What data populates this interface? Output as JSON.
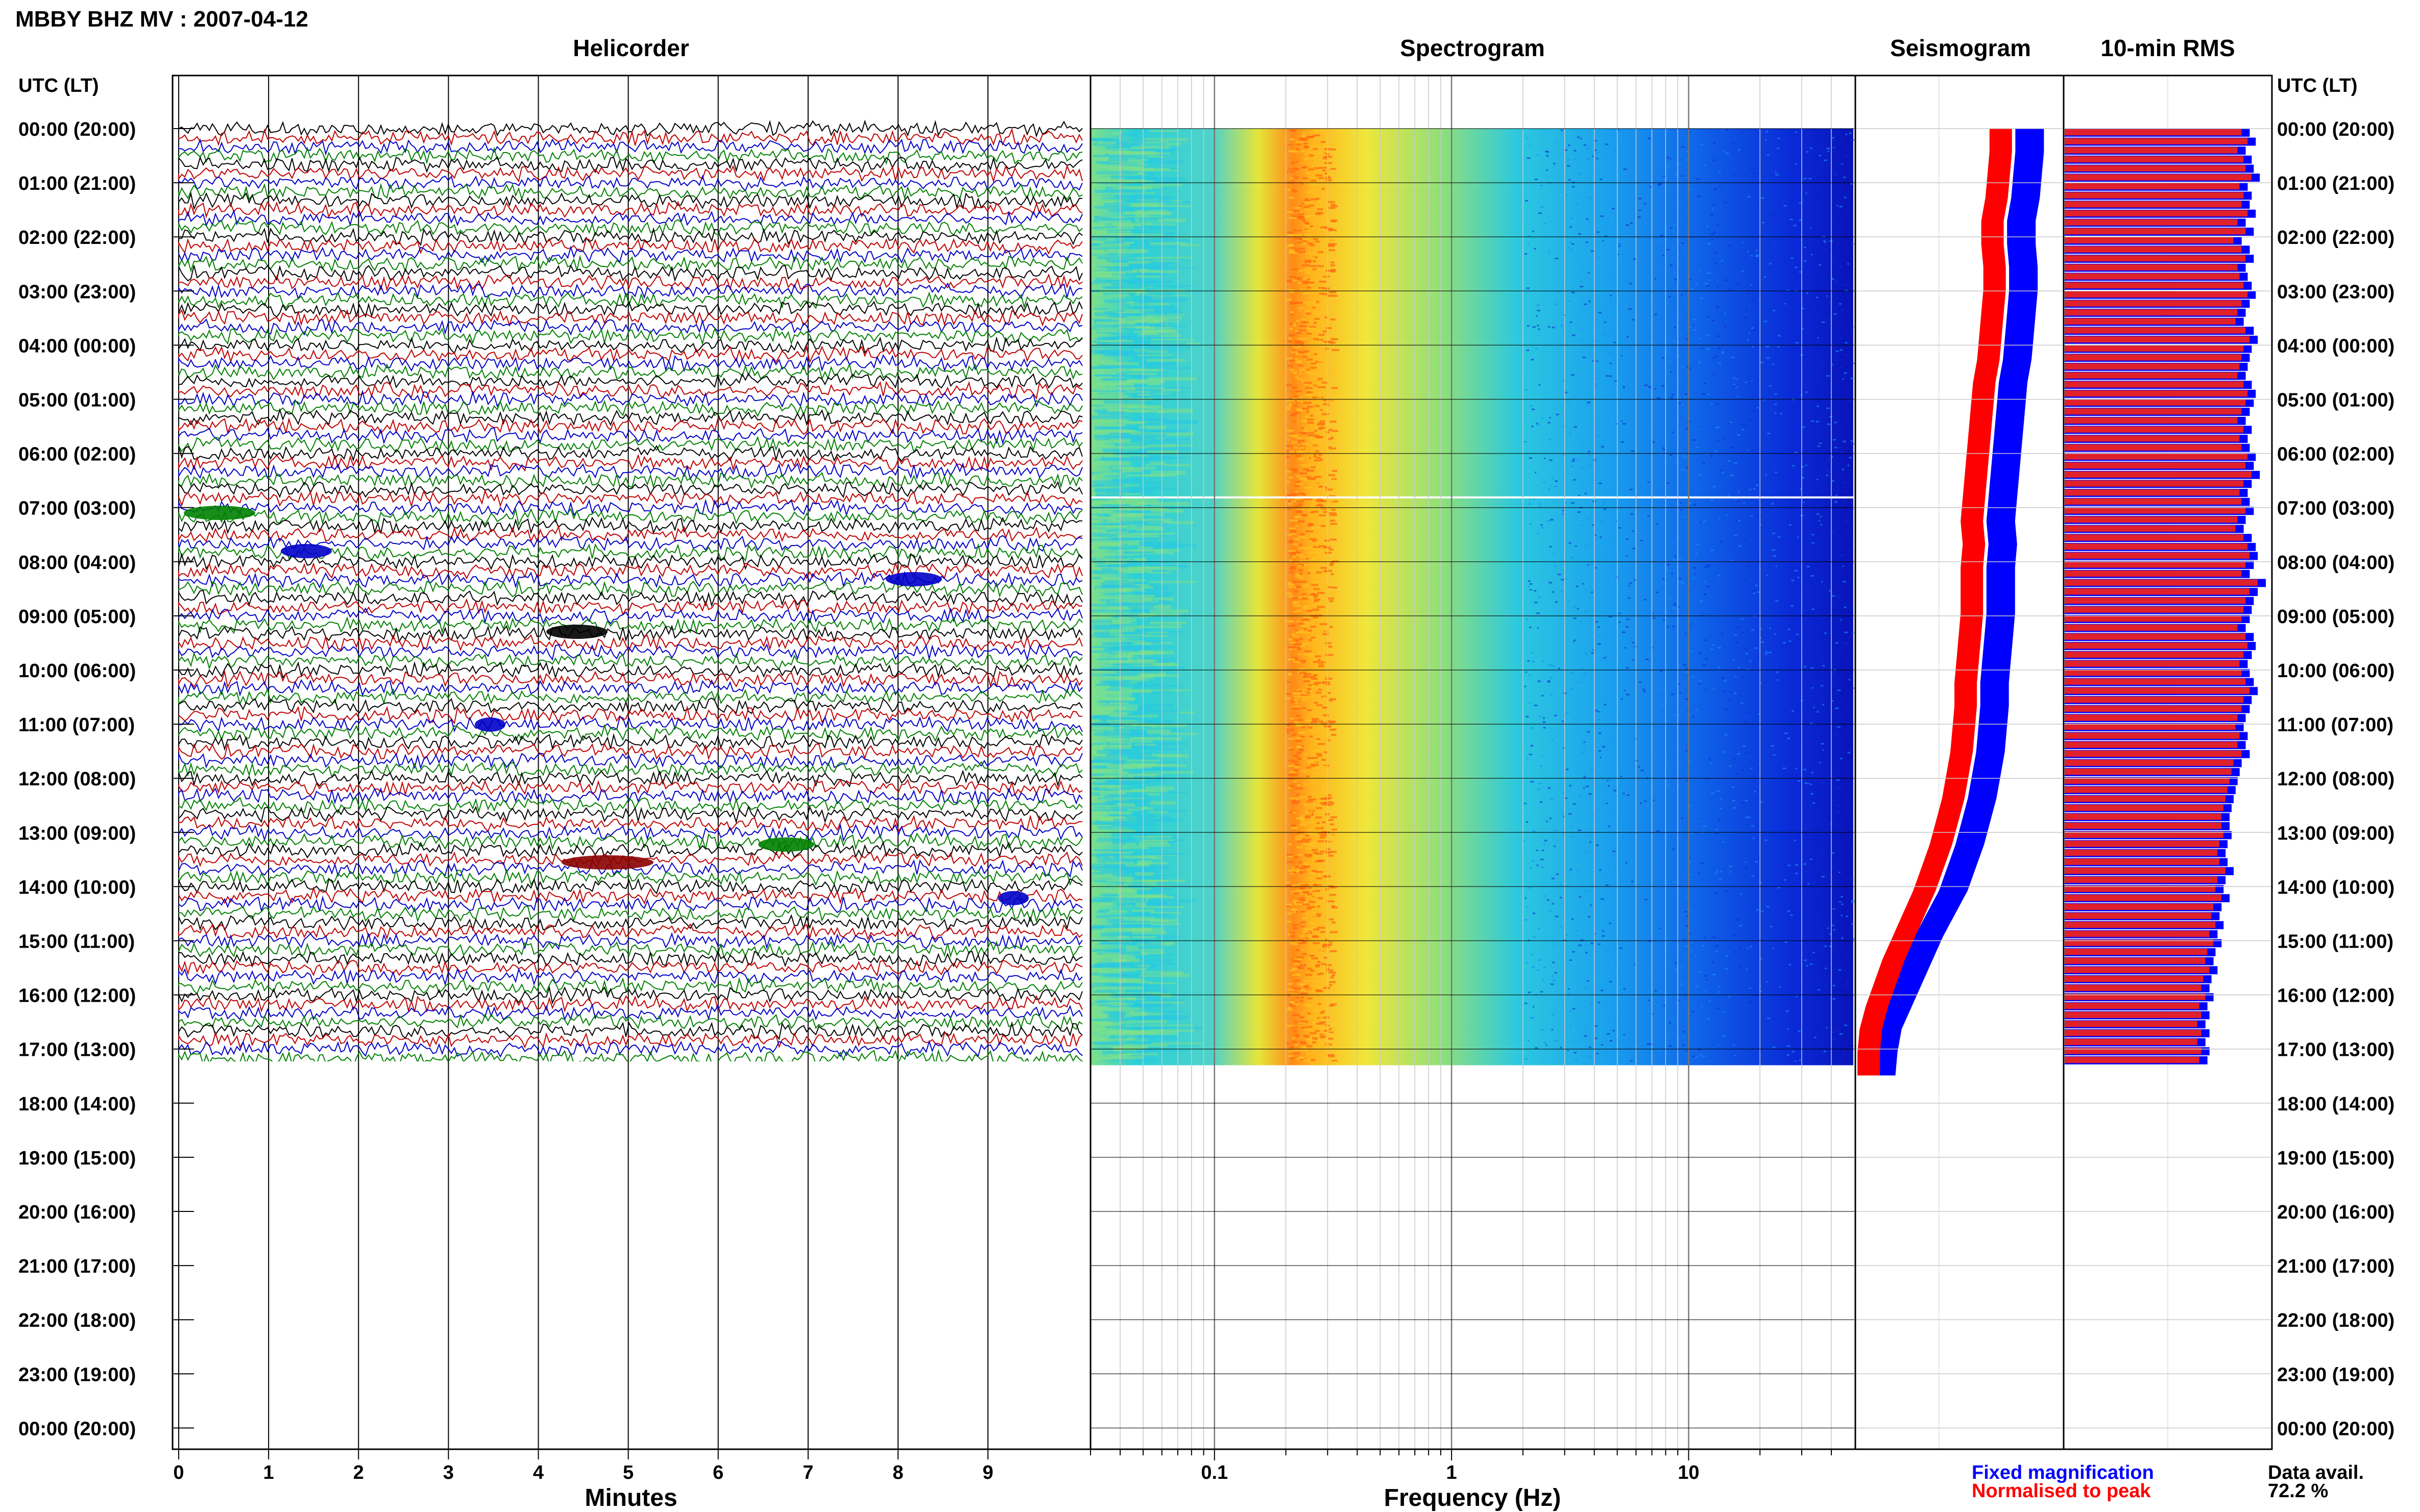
{
  "header": {
    "title": "MBBY BHZ MV : 2007-04-12"
  },
  "panels": {
    "helicorder": "Helicorder",
    "spectrogram": "Spectrogram",
    "seismogram": "Seismogram",
    "rms": "10-min RMS"
  },
  "axis": {
    "time_header_left": "UTC (LT)",
    "time_header_right": "UTC (LT)",
    "minutes_label": "Minutes",
    "frequency_label": "Frequency (Hz)",
    "minute_ticks": [
      "0",
      "1",
      "2",
      "3",
      "4",
      "5",
      "6",
      "7",
      "8",
      "9"
    ],
    "freq_ticks": [
      "0.1",
      "1",
      "10"
    ]
  },
  "legend": {
    "fixed": "Fixed magnification",
    "normalised": "Normalised to peak",
    "fixed_color": "#0000ff",
    "normalised_color": "#ff0000"
  },
  "availability": {
    "label": "Data avail.",
    "value": "72.2 %"
  },
  "chart_data": {
    "type": "heatmap",
    "time_labels": [
      "00:00 (20:00)",
      "01:00 (21:00)",
      "02:00 (22:00)",
      "03:00 (23:00)",
      "04:00 (00:00)",
      "05:00 (01:00)",
      "06:00 (02:00)",
      "07:00 (03:00)",
      "08:00 (04:00)",
      "09:00 (05:00)",
      "10:00 (06:00)",
      "11:00 (07:00)",
      "12:00 (08:00)",
      "13:00 (09:00)",
      "14:00 (10:00)",
      "15:00 (11:00)",
      "16:00 (12:00)",
      "17:00 (13:00)",
      "18:00 (14:00)",
      "19:00 (15:00)",
      "20:00 (16:00)",
      "21:00 (17:00)",
      "22:00 (18:00)",
      "23:00 (19:00)",
      "00:00 (20:00)"
    ],
    "data_hours": 17.3,
    "data_availability_percent": 72.2,
    "minutes_range": [
      0,
      10
    ],
    "frequency_range_hz": [
      0.03,
      50
    ],
    "frequency_scale": "log",
    "trace_colors": [
      "#000000",
      "#c00000",
      "#0000c8",
      "#008000"
    ],
    "spectrogram_peak_hz": 0.25,
    "seismogram_fixed_rel_x": [
      0.84,
      0.84,
      0.83,
      0.82,
      0.8,
      0.8,
      0.81,
      0.81,
      0.8,
      0.79,
      0.78,
      0.76,
      0.75,
      0.74,
      0.73,
      0.72,
      0.71,
      0.7,
      0.71,
      0.7,
      0.7,
      0.7,
      0.69,
      0.68,
      0.67,
      0.67,
      0.66,
      0.65,
      0.63,
      0.61,
      0.58,
      0.55,
      0.51,
      0.47,
      0.41,
      0.35,
      0.3,
      0.25,
      0.2,
      0.15,
      0.13,
      0.12
    ],
    "seismogram_norm_rel_x": [
      0.7,
      0.7,
      0.69,
      0.68,
      0.66,
      0.66,
      0.67,
      0.67,
      0.66,
      0.65,
      0.64,
      0.62,
      0.61,
      0.6,
      0.59,
      0.58,
      0.57,
      0.56,
      0.57,
      0.56,
      0.56,
      0.56,
      0.55,
      0.54,
      0.53,
      0.53,
      0.52,
      0.51,
      0.49,
      0.47,
      0.44,
      0.41,
      0.37,
      0.33,
      0.28,
      0.23,
      0.18,
      0.14,
      0.1,
      0.07,
      0.06,
      0.06
    ],
    "rms_rel": [
      0.92,
      0.95,
      0.9,
      0.93,
      0.94,
      0.97,
      0.91,
      0.93,
      0.92,
      0.95,
      0.9,
      0.94,
      0.88,
      0.92,
      0.94,
      0.9,
      0.91,
      0.93,
      0.95,
      0.92,
      0.9,
      0.89,
      0.94,
      0.96,
      0.93,
      0.92,
      0.91,
      0.9,
      0.93,
      0.95,
      0.94,
      0.92,
      0.9,
      0.93,
      0.91,
      0.92,
      0.95,
      0.94,
      0.97,
      0.93,
      0.91,
      0.92,
      0.94,
      0.9,
      0.89,
      0.93,
      0.95,
      0.96,
      0.94,
      0.92,
      1.0,
      0.96,
      0.94,
      0.93,
      0.92,
      0.9,
      0.94,
      0.95,
      0.93,
      0.91,
      0.92,
      0.94,
      0.96,
      0.93,
      0.92,
      0.9,
      0.89,
      0.91,
      0.9,
      0.92,
      0.88,
      0.87,
      0.86,
      0.85,
      0.84,
      0.83,
      0.82,
      0.82,
      0.83,
      0.81,
      0.8,
      0.81,
      0.84,
      0.8,
      0.79,
      0.82,
      0.78,
      0.77,
      0.79,
      0.76,
      0.78,
      0.75,
      0.74,
      0.76,
      0.73,
      0.72,
      0.74,
      0.71,
      0.72,
      0.7,
      0.72,
      0.7,
      0.72,
      0.71
    ]
  }
}
